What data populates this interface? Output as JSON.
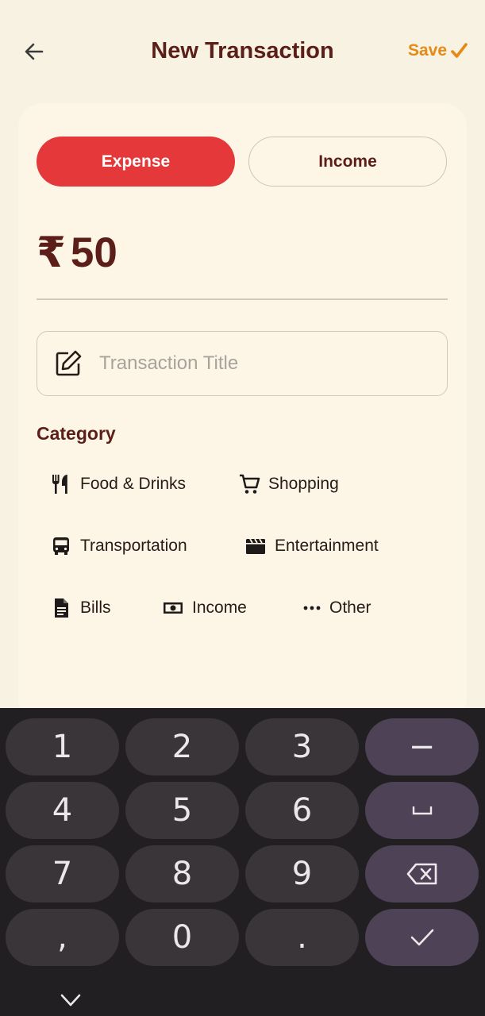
{
  "header": {
    "title": "New Transaction",
    "save_label": "Save"
  },
  "type_toggle": {
    "expense_label": "Expense",
    "income_label": "Income",
    "selected": "Expense"
  },
  "amount": {
    "currency_symbol": "₹",
    "value": "50"
  },
  "title_input": {
    "placeholder": "Transaction Title",
    "value": ""
  },
  "categories": {
    "heading": "Category",
    "items": [
      {
        "label": "Food & Drinks",
        "icon": "utensils-icon"
      },
      {
        "label": "Shopping",
        "icon": "cart-icon"
      },
      {
        "label": "Transportation",
        "icon": "bus-icon"
      },
      {
        "label": "Entertainment",
        "icon": "clapperboard-icon"
      },
      {
        "label": "Bills",
        "icon": "document-icon"
      },
      {
        "label": "Income",
        "icon": "cash-icon"
      },
      {
        "label": "Other",
        "icon": "more-dots-icon"
      }
    ]
  },
  "keyboard": {
    "keys": [
      "1",
      "2",
      "3",
      "−",
      "4",
      "5",
      "6",
      "␣",
      "7",
      "8",
      "9",
      "⌫",
      ",",
      "0",
      ".",
      "✓"
    ]
  },
  "colors": {
    "accent": "#e5383a",
    "save": "#e58a16",
    "title": "#5c1e19",
    "background": "#f8f2e3"
  }
}
